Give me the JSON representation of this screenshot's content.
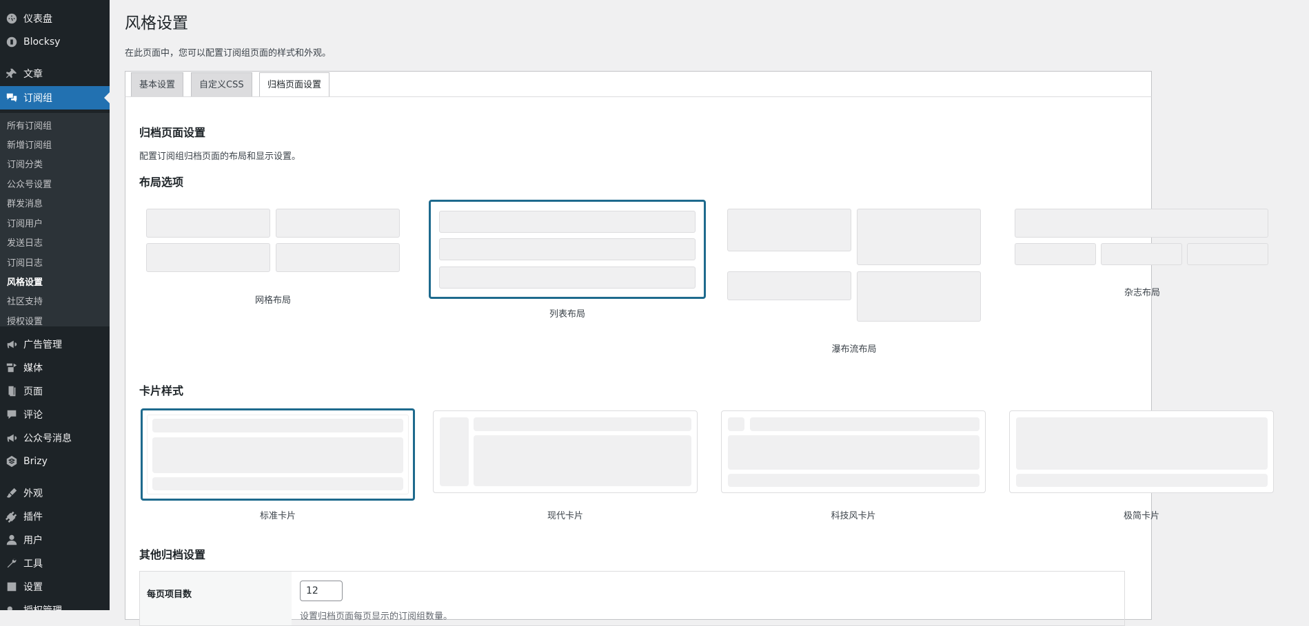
{
  "sidebar": {
    "items": [
      {
        "label": "仪表盘",
        "icon": "dashboard-icon"
      },
      {
        "label": "Blocksy",
        "icon": "blocksy-icon"
      },
      {
        "label": "文章",
        "icon": "pin-icon"
      },
      {
        "label": "订阅组",
        "icon": "chat-icon"
      },
      {
        "label": "广告管理",
        "icon": "megaphone-icon"
      },
      {
        "label": "媒体",
        "icon": "media-icon"
      },
      {
        "label": "页面",
        "icon": "page-icon"
      },
      {
        "label": "评论",
        "icon": "comment-icon"
      },
      {
        "label": "公众号消息",
        "icon": "megaphone-icon"
      },
      {
        "label": "Brizy",
        "icon": "brizy-icon"
      },
      {
        "label": "外观",
        "icon": "brush-icon"
      },
      {
        "label": "插件",
        "icon": "plugin-icon"
      },
      {
        "label": "用户",
        "icon": "user-icon"
      },
      {
        "label": "工具",
        "icon": "wrench-icon"
      },
      {
        "label": "设置",
        "icon": "settings-icon"
      },
      {
        "label": "授权管理",
        "icon": "key-icon"
      }
    ],
    "submenu": [
      "所有订阅组",
      "新增订阅组",
      "订阅分类",
      "公众号设置",
      "群发消息",
      "订阅用户",
      "发送日志",
      "订阅日志",
      "风格设置",
      "社区支持",
      "授权设置"
    ]
  },
  "page": {
    "title": "风格设置",
    "description": "在此页面中，您可以配置订阅组页面的样式和外观。"
  },
  "tabs": [
    "基本设置",
    "自定义CSS",
    "归档页面设置"
  ],
  "archive": {
    "heading": "归档页面设置",
    "description": "配置订阅组归档页面的布局和显示设置。",
    "layout_heading": "布局选项",
    "layouts": [
      "网格布局",
      "列表布局",
      "瀑布流布局",
      "杂志布局"
    ],
    "card_heading": "卡片样式",
    "cards": [
      "标准卡片",
      "现代卡片",
      "科技风卡片",
      "极简卡片"
    ],
    "other_heading": "其他归档设置",
    "per_page_label": "每页项目数",
    "per_page_value": "12",
    "per_page_help": "设置归档页面每页显示的订阅组数量。"
  },
  "colors": {
    "accent": "#2271b1",
    "selected_border": "#1e6a8d",
    "sidebar_bg": "#1d2327"
  }
}
